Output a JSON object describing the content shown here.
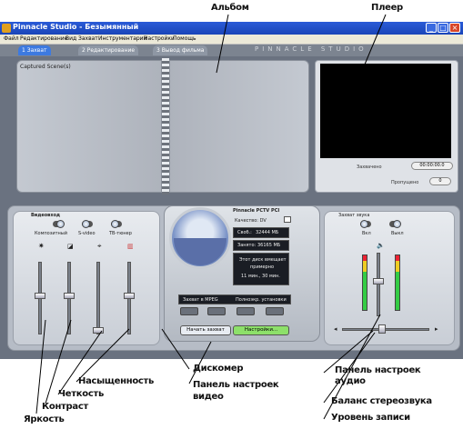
{
  "annotations": {
    "album": "Альбом",
    "player": "Плеер",
    "saturation": "Насыщенность",
    "sharpness": "Четкость",
    "contrast": "Контраст",
    "brightness": "Яркость",
    "disc_meter": "Дискомер",
    "video_settings_l1": "Панель настроек",
    "video_settings_l2": "видео",
    "audio_settings_l1": "Панель настроек",
    "audio_settings_l2": "аудио",
    "stereo_balance": "Баланс стереозвука",
    "record_level": "Уровень записи"
  },
  "window": {
    "title": "Pinnacle Studio - Безымянный",
    "minimize": "_",
    "maximize": "□",
    "close": "×"
  },
  "menu": [
    "Файл",
    "Редактирование",
    "Вид",
    "Захват",
    "Инструментарий",
    "Настройки",
    "Помощь"
  ],
  "tabs": {
    "capture": "1 Захват",
    "edit": "2 Редактирование",
    "output": "3 Вывод фильма",
    "brand": "PINNACLE STUDIO"
  },
  "album": {
    "caption": "Captured Scene(s)"
  },
  "player": {
    "counter_label": "Захвачено",
    "counter_value": "00:00:00.0",
    "dropped_label": "Пропущено",
    "dropped_value": "0"
  },
  "video_panel": {
    "title": "Видеовход",
    "modes": [
      "Композитный",
      "S-video",
      "ТВ-тюнер"
    ]
  },
  "disc_meter": {
    "device": "Pinnacle PCTV PCI",
    "format_label": "Качество: DV",
    "free_label": "Своб.:",
    "free_value": "32444 МБ",
    "used_label": "Занято:",
    "used_value": "36165 МБ",
    "estimate_l1": "Этот диск вмещает",
    "estimate_l2": "примерно",
    "estimate_l3": "11 мин., 30 мин.",
    "quality_left": "Захват в MPEG",
    "quality_right": "Полноэкр. установки",
    "start_capture": "Начать захват",
    "settings": "Настройки..."
  },
  "audio_panel": {
    "title": "Захват звука",
    "on": "Вкл",
    "off": "Выкл"
  }
}
